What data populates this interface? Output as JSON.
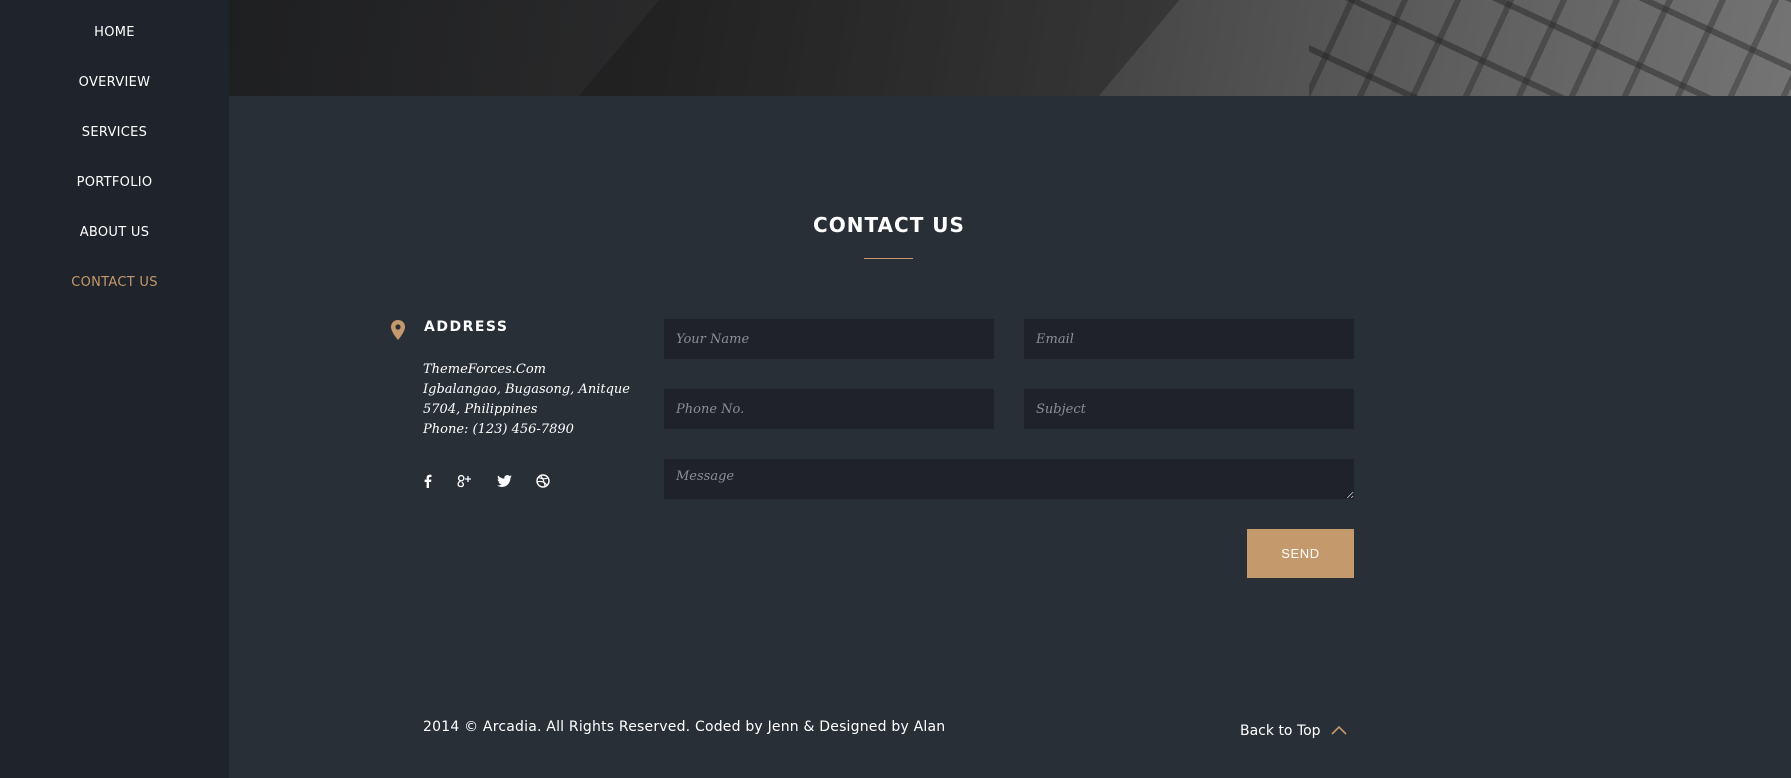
{
  "nav": {
    "items": [
      {
        "label": "HOME",
        "active": false
      },
      {
        "label": "OVERVIEW",
        "active": false
      },
      {
        "label": "SERVICES",
        "active": false
      },
      {
        "label": "PORTFOLIO",
        "active": false
      },
      {
        "label": "ABOUT US",
        "active": false
      },
      {
        "label": "CONTACT US",
        "active": true
      }
    ]
  },
  "contact": {
    "title": "CONTACT US",
    "address_heading": "ADDRESS",
    "address_lines": [
      "ThemeForces.Com",
      "Igbalangao, Bugasong, Anitque",
      "5704, Philippines",
      "Phone: (123) 456-7890"
    ],
    "social_icons": [
      "facebook-icon",
      "google-plus-icon",
      "twitter-icon",
      "dribbble-icon"
    ]
  },
  "form": {
    "name_placeholder": "Your Name",
    "email_placeholder": "Email",
    "phone_placeholder": "Phone No.",
    "subject_placeholder": "Subject",
    "message_placeholder": "Message",
    "send_label": "SEND"
  },
  "footer": {
    "copyright": "2014 © Arcadia. All Rights Reserved. Coded by Jenn & Designed by Alan",
    "back_to_top": "Back to Top"
  },
  "colors": {
    "accent": "#c4996c",
    "sidebar": "#1f232b",
    "background": "#292f37",
    "input": "#1f2229"
  }
}
